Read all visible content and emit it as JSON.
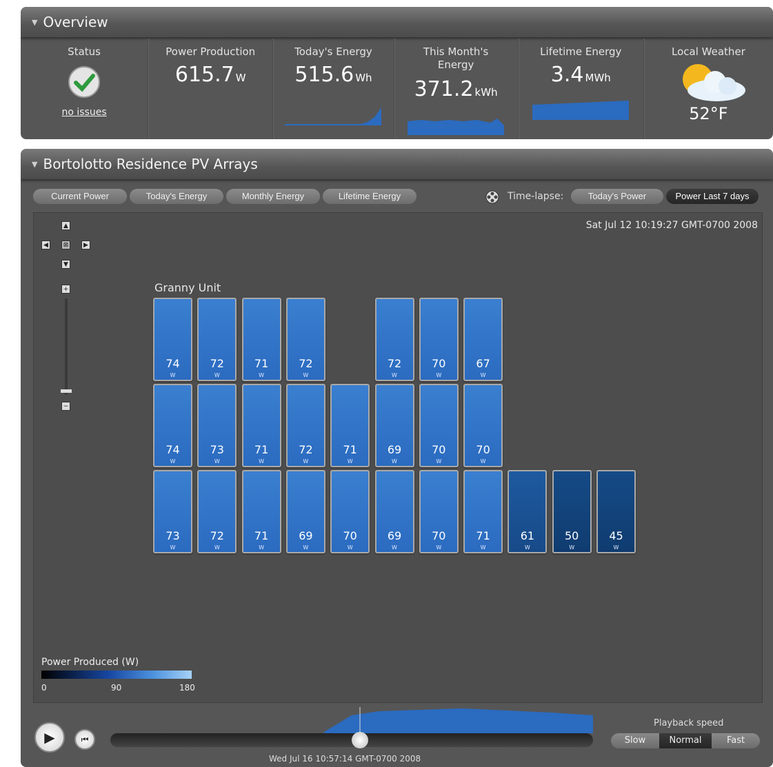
{
  "overview": {
    "title": "Overview",
    "status": {
      "label": "Status",
      "text": "no issues"
    },
    "power": {
      "label": "Power Production",
      "value": "615.7",
      "unit": "W"
    },
    "today": {
      "label": "Today's Energy",
      "value": "515.6",
      "unit": "Wh"
    },
    "month": {
      "label": "This Month's Energy",
      "value": "371.2",
      "unit": "kWh"
    },
    "lifetime": {
      "label": "Lifetime Energy",
      "value": "3.4",
      "unit": "MWh"
    },
    "weather": {
      "label": "Local Weather",
      "value": "52°F"
    }
  },
  "arrays": {
    "title": "Bortolotto Residence PV Arrays",
    "tabs": [
      "Current Power",
      "Today's Energy",
      "Monthly Energy",
      "Lifetime Energy"
    ],
    "timelapse_label": "Time-lapse:",
    "timelapse_tabs": [
      "Today's Power",
      "Power Last 7 days"
    ],
    "timestamp": "Sat Jul 12 10:19:27 GMT-0700 2008",
    "group_label": "Granny Unit",
    "unit": "W",
    "rows": [
      [
        74,
        72,
        71,
        72,
        null,
        72,
        70,
        67
      ],
      [
        74,
        73,
        71,
        72,
        71,
        69,
        70,
        70
      ],
      [
        73,
        72,
        71,
        69,
        70,
        69,
        70,
        71,
        61,
        50,
        45
      ]
    ],
    "legend": {
      "title": "Power Produced (W)",
      "ticks": [
        "0",
        "90",
        "180"
      ]
    },
    "playback": {
      "date": "Wed Jul 16 10:57:14 GMT-0700 2008",
      "speed_label": "Playback speed",
      "speeds": [
        "Slow",
        "Normal",
        "Fast"
      ],
      "selected_speed": "Normal"
    }
  },
  "colors": {
    "panel": "#2b6bc0",
    "bg": "#565656",
    "accent": "#3a7fd0"
  }
}
